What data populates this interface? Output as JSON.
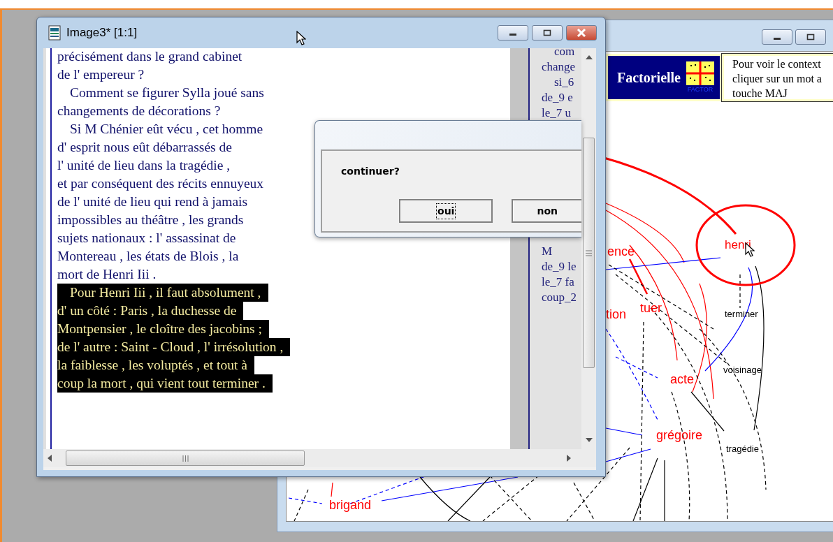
{
  "graph_window": {
    "banner": {
      "title": "Factorielle",
      "logo_text": "FACTOR",
      "hint_lines": [
        "Pour voir le context",
        "cliquer sur un mot a",
        "touche MAJ"
      ]
    },
    "nodes": [
      {
        "label": "ence",
        "color": "#ff0000"
      },
      {
        "label": "tion",
        "color": "#ff0000"
      },
      {
        "label": "tuer",
        "color": "#ff0000"
      },
      {
        "label": "henri",
        "color": "#ff0000"
      },
      {
        "label": "terminer",
        "color": "#000000"
      },
      {
        "label": "voisinage",
        "color": "#000000"
      },
      {
        "label": "acte",
        "color": "#ff0000"
      },
      {
        "label": "grégoire",
        "color": "#ff0000"
      },
      {
        "label": "tragédie",
        "color": "#000000"
      },
      {
        "label": "brigand",
        "color": "#ff0000"
      }
    ]
  },
  "text_window": {
    "title": "Image3* [1:1]",
    "lines": [
      {
        "text": "précisément dans le grand cabinet",
        "indented": false,
        "highlighted": false
      },
      {
        "text": "de l' empereur ?",
        "indented": false,
        "highlighted": false
      },
      {
        "text": "Comment se figurer Sylla joué sans",
        "indented": true,
        "highlighted": false
      },
      {
        "text": "changements de décorations ?",
        "indented": false,
        "highlighted": false
      },
      {
        "text": "Si M Chénier eût vécu , cet homme",
        "indented": true,
        "highlighted": false
      },
      {
        "text": "d' esprit nous eût débarrassés de",
        "indented": false,
        "highlighted": false
      },
      {
        "text": "l' unité de lieu dans la tragédie ,",
        "indented": false,
        "highlighted": false
      },
      {
        "text": "et par conséquent des récits ennuyeux",
        "indented": false,
        "highlighted": false
      },
      {
        "text": "de l' unité de lieu qui rend à jamais",
        "indented": false,
        "highlighted": false
      },
      {
        "text": "impossibles au théâtre , les grands",
        "indented": false,
        "highlighted": false
      },
      {
        "text": "sujets nationaux : l' assassinat de",
        "indented": false,
        "highlighted": false
      },
      {
        "text": "Montereau , les états de Blois , la",
        "indented": false,
        "highlighted": false
      },
      {
        "text": "mort de Henri Iii .",
        "indented": false,
        "highlighted": false
      },
      {
        "text": "Pour Henri Iii , il faut absolument ,",
        "indented": true,
        "highlighted": true
      },
      {
        "text": "d' un côté : Paris , la duchesse de",
        "indented": false,
        "highlighted": true
      },
      {
        "text": "Montpensier , le cloître des jacobins ;",
        "indented": false,
        "highlighted": true
      },
      {
        "text": "de l' autre : Saint - Cloud , l' irrésolution ,",
        "indented": false,
        "highlighted": true
      },
      {
        "text": "la faiblesse , les voluptés , et tout à",
        "indented": false,
        "highlighted": true
      },
      {
        "text": "coup la mort , qui vient tout terminer .",
        "indented": false,
        "highlighted": true
      }
    ],
    "side_panel": {
      "upper_lines": [
        {
          "text": "com",
          "indented": true
        },
        {
          "text": "change",
          "indented": false
        },
        {
          "text": "si_6",
          "indented": true
        },
        {
          "text": "de_9 e",
          "indented": false
        },
        {
          "text": "le_7 u",
          "indented": false
        }
      ],
      "lower_lines": [
        {
          "text": "M",
          "indented": false
        },
        {
          "text": "de_9 le",
          "indented": false
        },
        {
          "text": "le_7 fa",
          "indented": false
        },
        {
          "text": "coup_2",
          "indented": false
        }
      ]
    }
  },
  "dialog": {
    "message": "continuer?",
    "buttons": [
      {
        "label": "oui",
        "focused": true
      },
      {
        "label": "non",
        "focused": false
      }
    ]
  }
}
